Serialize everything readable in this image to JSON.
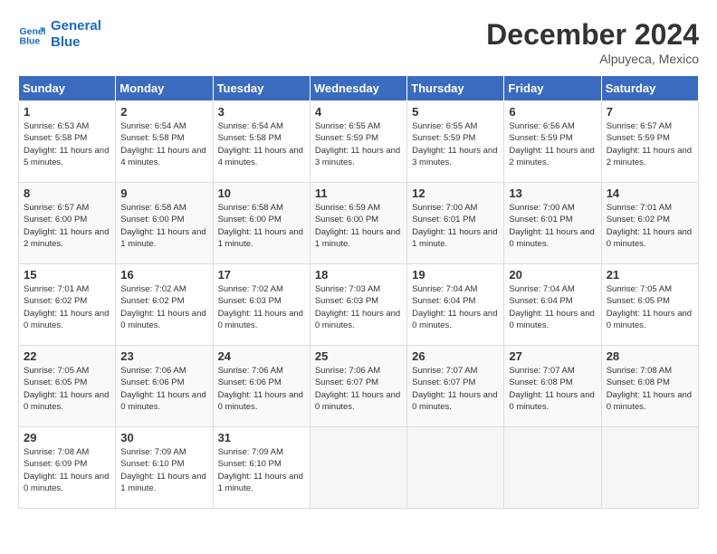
{
  "logo": {
    "line1": "General",
    "line2": "Blue"
  },
  "title": "December 2024",
  "location": "Alpuyeca, Mexico",
  "days_of_week": [
    "Sunday",
    "Monday",
    "Tuesday",
    "Wednesday",
    "Thursday",
    "Friday",
    "Saturday"
  ],
  "weeks": [
    [
      {
        "day": 1,
        "sunrise": "6:53 AM",
        "sunset": "5:58 PM",
        "daylight": "11 hours and 5 minutes."
      },
      {
        "day": 2,
        "sunrise": "6:54 AM",
        "sunset": "5:58 PM",
        "daylight": "11 hours and 4 minutes."
      },
      {
        "day": 3,
        "sunrise": "6:54 AM",
        "sunset": "5:58 PM",
        "daylight": "11 hours and 4 minutes."
      },
      {
        "day": 4,
        "sunrise": "6:55 AM",
        "sunset": "5:59 PM",
        "daylight": "11 hours and 3 minutes."
      },
      {
        "day": 5,
        "sunrise": "6:55 AM",
        "sunset": "5:59 PM",
        "daylight": "11 hours and 3 minutes."
      },
      {
        "day": 6,
        "sunrise": "6:56 AM",
        "sunset": "5:59 PM",
        "daylight": "11 hours and 2 minutes."
      },
      {
        "day": 7,
        "sunrise": "6:57 AM",
        "sunset": "5:59 PM",
        "daylight": "11 hours and 2 minutes."
      }
    ],
    [
      {
        "day": 8,
        "sunrise": "6:57 AM",
        "sunset": "6:00 PM",
        "daylight": "11 hours and 2 minutes."
      },
      {
        "day": 9,
        "sunrise": "6:58 AM",
        "sunset": "6:00 PM",
        "daylight": "11 hours and 1 minute."
      },
      {
        "day": 10,
        "sunrise": "6:58 AM",
        "sunset": "6:00 PM",
        "daylight": "11 hours and 1 minute."
      },
      {
        "day": 11,
        "sunrise": "6:59 AM",
        "sunset": "6:00 PM",
        "daylight": "11 hours and 1 minute."
      },
      {
        "day": 12,
        "sunrise": "7:00 AM",
        "sunset": "6:01 PM",
        "daylight": "11 hours and 1 minute."
      },
      {
        "day": 13,
        "sunrise": "7:00 AM",
        "sunset": "6:01 PM",
        "daylight": "11 hours and 0 minutes."
      },
      {
        "day": 14,
        "sunrise": "7:01 AM",
        "sunset": "6:02 PM",
        "daylight": "11 hours and 0 minutes."
      }
    ],
    [
      {
        "day": 15,
        "sunrise": "7:01 AM",
        "sunset": "6:02 PM",
        "daylight": "11 hours and 0 minutes."
      },
      {
        "day": 16,
        "sunrise": "7:02 AM",
        "sunset": "6:02 PM",
        "daylight": "11 hours and 0 minutes."
      },
      {
        "day": 17,
        "sunrise": "7:02 AM",
        "sunset": "6:03 PM",
        "daylight": "11 hours and 0 minutes."
      },
      {
        "day": 18,
        "sunrise": "7:03 AM",
        "sunset": "6:03 PM",
        "daylight": "11 hours and 0 minutes."
      },
      {
        "day": 19,
        "sunrise": "7:04 AM",
        "sunset": "6:04 PM",
        "daylight": "11 hours and 0 minutes."
      },
      {
        "day": 20,
        "sunrise": "7:04 AM",
        "sunset": "6:04 PM",
        "daylight": "11 hours and 0 minutes."
      },
      {
        "day": 21,
        "sunrise": "7:05 AM",
        "sunset": "6:05 PM",
        "daylight": "11 hours and 0 minutes."
      }
    ],
    [
      {
        "day": 22,
        "sunrise": "7:05 AM",
        "sunset": "6:05 PM",
        "daylight": "11 hours and 0 minutes."
      },
      {
        "day": 23,
        "sunrise": "7:06 AM",
        "sunset": "6:06 PM",
        "daylight": "11 hours and 0 minutes."
      },
      {
        "day": 24,
        "sunrise": "7:06 AM",
        "sunset": "6:06 PM",
        "daylight": "11 hours and 0 minutes."
      },
      {
        "day": 25,
        "sunrise": "7:06 AM",
        "sunset": "6:07 PM",
        "daylight": "11 hours and 0 minutes."
      },
      {
        "day": 26,
        "sunrise": "7:07 AM",
        "sunset": "6:07 PM",
        "daylight": "11 hours and 0 minutes."
      },
      {
        "day": 27,
        "sunrise": "7:07 AM",
        "sunset": "6:08 PM",
        "daylight": "11 hours and 0 minutes."
      },
      {
        "day": 28,
        "sunrise": "7:08 AM",
        "sunset": "6:08 PM",
        "daylight": "11 hours and 0 minutes."
      }
    ],
    [
      {
        "day": 29,
        "sunrise": "7:08 AM",
        "sunset": "6:09 PM",
        "daylight": "11 hours and 0 minutes."
      },
      {
        "day": 30,
        "sunrise": "7:09 AM",
        "sunset": "6:10 PM",
        "daylight": "11 hours and 1 minute."
      },
      {
        "day": 31,
        "sunrise": "7:09 AM",
        "sunset": "6:10 PM",
        "daylight": "11 hours and 1 minute."
      },
      null,
      null,
      null,
      null
    ]
  ],
  "labels": {
    "sunrise": "Sunrise:",
    "sunset": "Sunset:",
    "daylight": "Daylight:"
  }
}
